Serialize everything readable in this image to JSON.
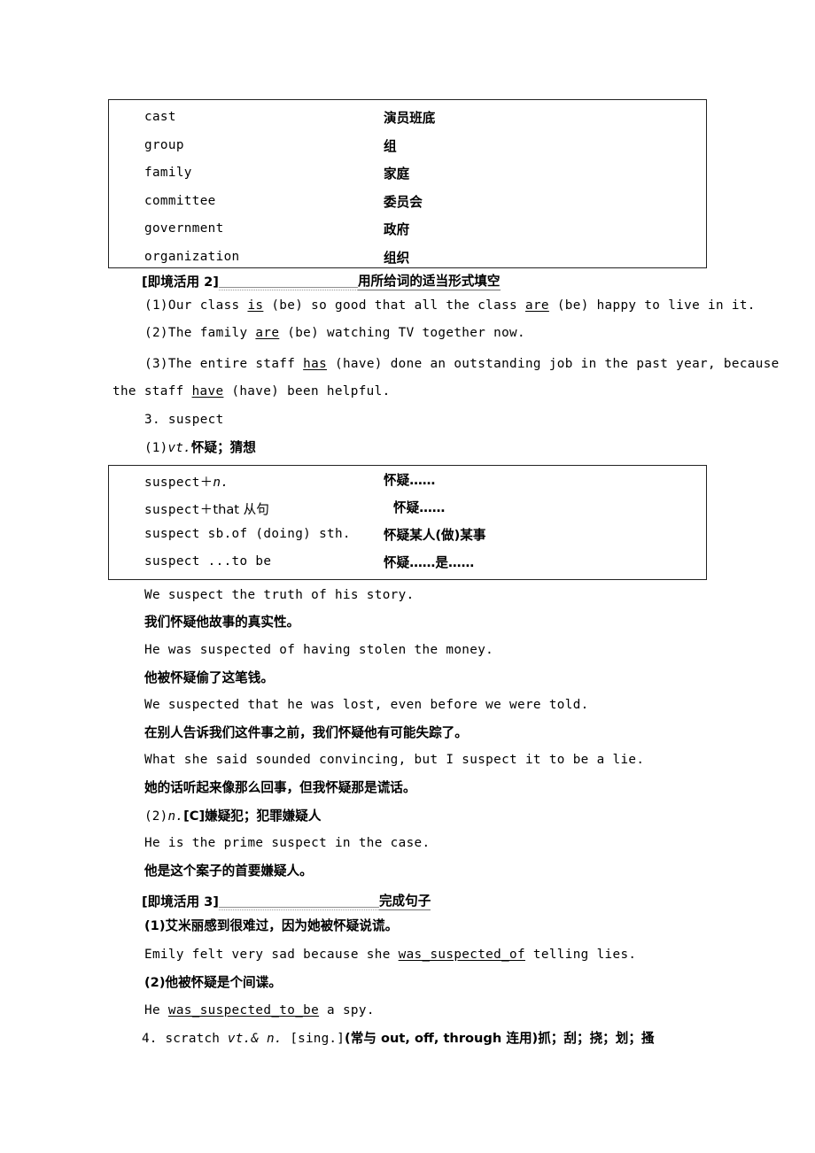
{
  "collective_nouns_table": {
    "name": "collective-nouns-table",
    "rows": [
      {
        "en": "cast",
        "cn": "演员班底"
      },
      {
        "en": "group",
        "cn": "组"
      },
      {
        "en": "family",
        "cn": "家庭"
      },
      {
        "en": "committee",
        "cn": "委员会"
      },
      {
        "en": "government",
        "cn": "政府"
      },
      {
        "en": "organization",
        "cn": "组织"
      }
    ]
  },
  "exercise2": {
    "tag": "[即境活用 2]",
    "title": "用所给词的适当形式填空",
    "items": [
      {
        "pre": "(1)Our class ",
        "ans1": "is",
        "mid": " (be) so good that all the class ",
        "ans2": "are",
        "post": " (be) happy to live in it."
      },
      {
        "pre": "(2)The family ",
        "ans1": "are",
        "mid": "",
        "ans2": "",
        "post": " (be) watching TV together now."
      },
      {
        "pre": "(3)The entire staff ",
        "ans1": "has",
        "mid": "",
        "ans2": "",
        "post": " (have) done an outstanding job in the past year, because"
      }
    ],
    "item3_wrap_pre": "the staff ",
    "item3_wrap_ans": "have",
    "item3_wrap_post": " (have) been helpful."
  },
  "entry3": {
    "number_word": "3. suspect",
    "sense1_label": "(1)",
    "sense1_pos": "vt.",
    "sense1_gloss": "怀疑；猜想",
    "patterns_table": {
      "rows": [
        {
          "en_plain": "suspect",
          "en_plus": "＋",
          "en_rest": "n.",
          "en_italic_tail": true,
          "cn": "怀疑……",
          "cn_indent": 0
        },
        {
          "en_plain": "suspect",
          "en_plus": "＋",
          "en_rest": "that 从句",
          "en_italic_tail": false,
          "cn": "怀疑……",
          "cn_indent": 11
        },
        {
          "en_plain": "suspect sb.of (doing) sth.",
          "en_plus": "",
          "en_rest": "",
          "en_italic_tail": false,
          "cn": "怀疑某人(做)某事",
          "cn_indent": 0
        },
        {
          "en_plain": "suspect ...to be",
          "en_plus": "",
          "en_rest": "",
          "en_italic_tail": false,
          "cn": "怀疑……是……",
          "cn_indent": 0
        }
      ]
    },
    "examples": [
      {
        "en": "We suspect the truth of his story.",
        "cn": "我们怀疑他故事的真实性。"
      },
      {
        "en": "He was suspected of having stolen the money.",
        "cn": "他被怀疑偷了这笔钱。"
      },
      {
        "en": "We suspected that he was lost, even before we were told.",
        "cn": "在别人告诉我们这件事之前，我们怀疑他有可能失踪了。"
      },
      {
        "en": "What she said sounded convincing, but I suspect it to be a lie.",
        "cn": "她的话听起来像那么回事，但我怀疑那是谎话。"
      }
    ],
    "sense2_label": "(2)",
    "sense2_pos": "n.",
    "sense2_gloss": "[C]嫌疑犯；犯罪嫌疑人",
    "sense2_example_en": "He is the prime suspect in the case.",
    "sense2_example_cn": "他是这个案子的首要嫌疑人。"
  },
  "exercise3": {
    "tag": "[即境活用 3]",
    "title": "完成句子",
    "items": [
      {
        "cn": "(1)艾米丽感到很难过，因为她被怀疑说谎。",
        "en_pre": "Emily felt very sad because she ",
        "en_ans": "was_suspected_of",
        "en_post": " telling lies."
      },
      {
        "cn": "(2)他被怀疑是个间谍。",
        "en_pre": "He ",
        "en_ans": "was_suspected_to_be",
        "en_post": " a spy."
      }
    ]
  },
  "entry4": {
    "number": "4. ",
    "word": "scratch ",
    "pos": "vt.& n.",
    "bracket": " [sing.]",
    "usage": "(常与 out, off, through 连用)抓；刮；挠；划；搔"
  }
}
